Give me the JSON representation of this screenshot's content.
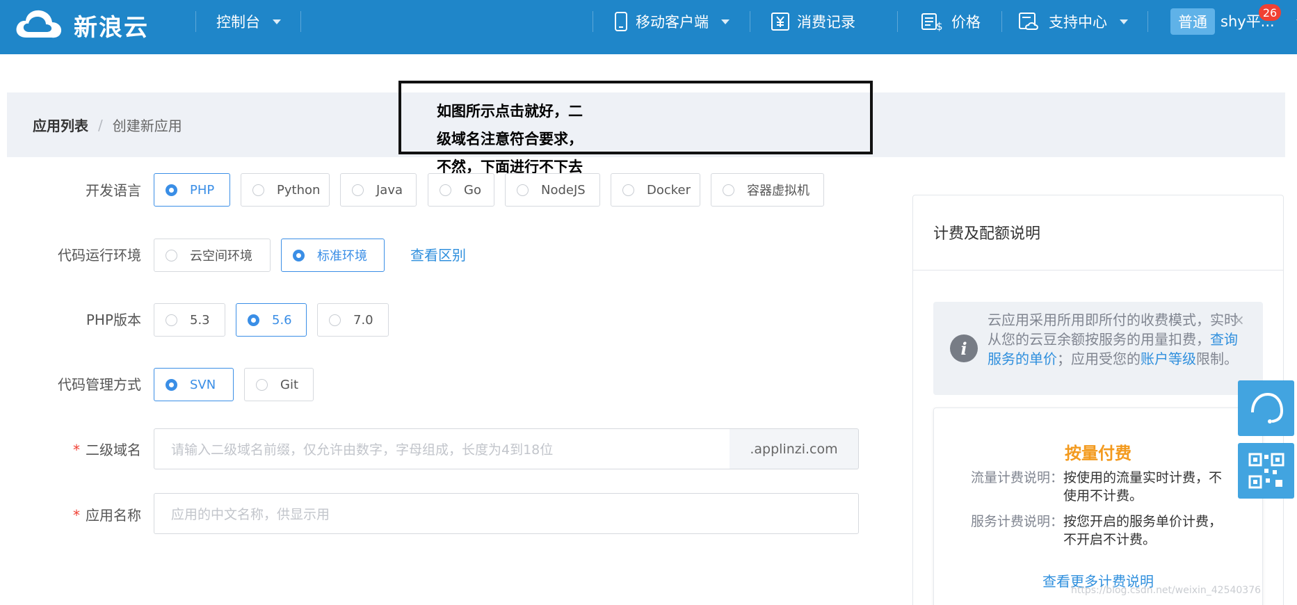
{
  "header": {
    "brand": "新浪云",
    "console": "控制台",
    "mobile_client": "移动客户端",
    "billing_records": "消费记录",
    "pricing": "价格",
    "support": "支持中心",
    "plan": "普通",
    "user": "shy平...",
    "notifications": "26"
  },
  "breadcrumb": {
    "parent": "应用列表",
    "separator": "/",
    "current": "创建新应用"
  },
  "annotation": {
    "line1": "如图所示点击就好，二",
    "line2": "级域名注意符合要求，",
    "line3": "不然，下面进行不下去"
  },
  "form": {
    "language": {
      "label": "开发语言",
      "options": [
        "PHP",
        "Python",
        "Java",
        "Go",
        "NodeJS",
        "Docker",
        "容器虚拟机"
      ],
      "selected": "PHP"
    },
    "runtime": {
      "label": "代码运行环境",
      "options": [
        "云空间环境",
        "标准环境"
      ],
      "selected": "标准环境",
      "diff_link": "查看区别"
    },
    "php_version": {
      "label": "PHP版本",
      "options": [
        "5.3",
        "5.6",
        "7.0"
      ],
      "selected": "5.6"
    },
    "vcs": {
      "label": "代码管理方式",
      "options": [
        "SVN",
        "Git"
      ],
      "selected": "SVN"
    },
    "subdomain": {
      "required_mark": "*",
      "label": "二级域名",
      "placeholder": "请输入二级域名前缀，仅允许由数字，字母组成，长度为4到18位",
      "suffix": ".applinzi.com"
    },
    "app_name": {
      "required_mark": "*",
      "label": "应用名称",
      "placeholder": "应用的中文名称，供显示用"
    }
  },
  "side_panel": {
    "title": "计费及配额说明",
    "notice": {
      "text1": "云应用采用所用即所付的收费模式，实时从您的云豆余额按服务的用量扣费，",
      "link1": "查询服务的单价",
      "text2": "；应用受您的",
      "link2": "账户等级",
      "text3": "限制。",
      "close": "×"
    },
    "billing": {
      "title": "按量付费",
      "traffic_key": "流量计费说明：",
      "traffic_val": "按使用的流量实时计费，不使用不计费。",
      "service_key": "服务计费说明：",
      "service_val": "按您开启的服务单价计费，不开启不计费。",
      "more_link": "查看更多计费说明"
    }
  },
  "watermark": "https://blog.csdn.net/weixin_42540376",
  "colors": {
    "topbar": "#1f86c9",
    "accent": "#3a8ee6",
    "billing_title": "#f39a1e",
    "float_button": "#42a4e0"
  }
}
